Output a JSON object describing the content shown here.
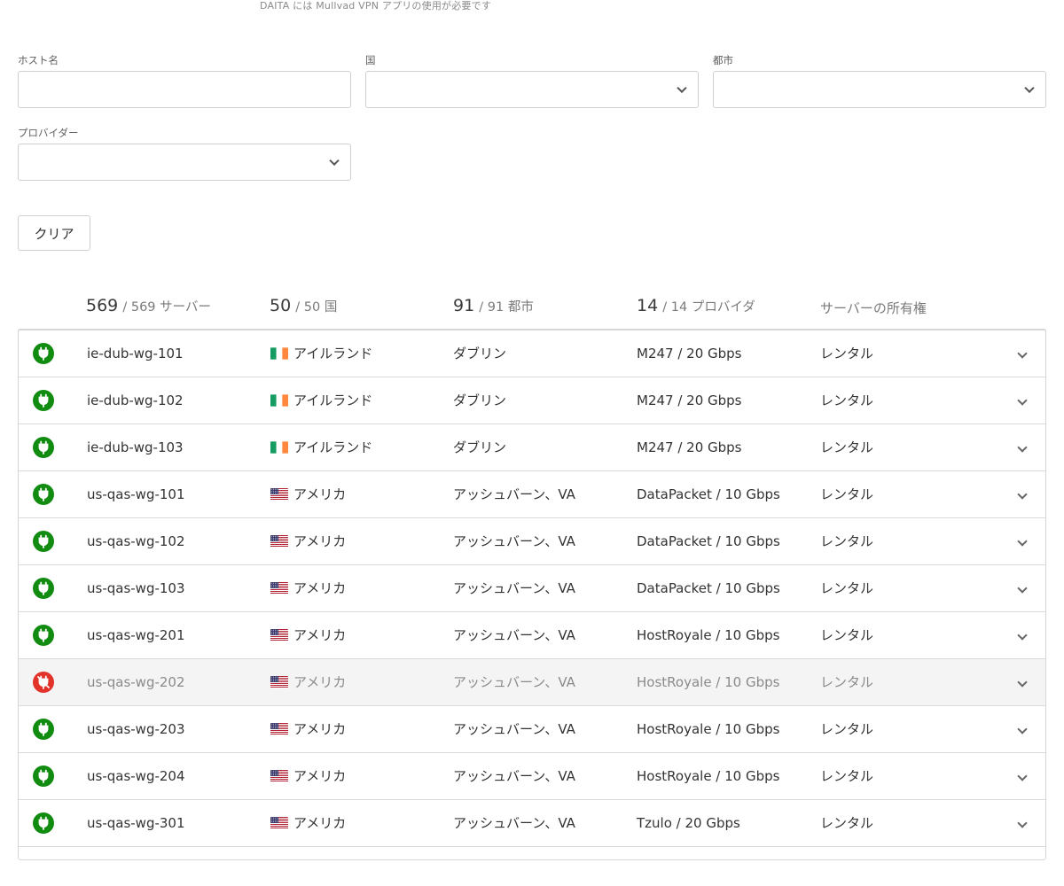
{
  "top_note": "DAITA には Mullvad VPN アプリの使用が必要です",
  "filters": {
    "hostname": {
      "label": "ホスト名",
      "value": "",
      "placeholder": ""
    },
    "country": {
      "label": "国",
      "value": ""
    },
    "city": {
      "label": "都市",
      "value": ""
    },
    "provider": {
      "label": "プロバイダー",
      "value": ""
    }
  },
  "clear_label": "クリア",
  "summary": {
    "servers": {
      "count": "569",
      "total": "/ 569 サーバー"
    },
    "countries": {
      "count": "50",
      "total": "/ 50 国"
    },
    "cities": {
      "count": "91",
      "total": "/ 91 都市"
    },
    "providers": {
      "count": "14",
      "total": "/ 14 プロバイダ"
    },
    "ownership_label": "サーバーの所有権"
  },
  "colors": {
    "active": "#118c11",
    "inactive": "#e2332b"
  },
  "servers": [
    {
      "hostname": "ie-dub-wg-101",
      "flag": "ie",
      "country": "アイルランド",
      "city": "ダブリン",
      "provider": "M247 / 20 Gbps",
      "ownership": "レンタル",
      "status": "active"
    },
    {
      "hostname": "ie-dub-wg-102",
      "flag": "ie",
      "country": "アイルランド",
      "city": "ダブリン",
      "provider": "M247 / 20 Gbps",
      "ownership": "レンタル",
      "status": "active"
    },
    {
      "hostname": "ie-dub-wg-103",
      "flag": "ie",
      "country": "アイルランド",
      "city": "ダブリン",
      "provider": "M247 / 20 Gbps",
      "ownership": "レンタル",
      "status": "active"
    },
    {
      "hostname": "us-qas-wg-101",
      "flag": "us",
      "country": "アメリカ",
      "city": "アッシュバーン、VA",
      "provider": "DataPacket / 10 Gbps",
      "ownership": "レンタル",
      "status": "active"
    },
    {
      "hostname": "us-qas-wg-102",
      "flag": "us",
      "country": "アメリカ",
      "city": "アッシュバーン、VA",
      "provider": "DataPacket / 10 Gbps",
      "ownership": "レンタル",
      "status": "active"
    },
    {
      "hostname": "us-qas-wg-103",
      "flag": "us",
      "country": "アメリカ",
      "city": "アッシュバーン、VA",
      "provider": "DataPacket / 10 Gbps",
      "ownership": "レンタル",
      "status": "active"
    },
    {
      "hostname": "us-qas-wg-201",
      "flag": "us",
      "country": "アメリカ",
      "city": "アッシュバーン、VA",
      "provider": "HostRoyale / 10 Gbps",
      "ownership": "レンタル",
      "status": "active"
    },
    {
      "hostname": "us-qas-wg-202",
      "flag": "us",
      "country": "アメリカ",
      "city": "アッシュバーン、VA",
      "provider": "HostRoyale / 10 Gbps",
      "ownership": "レンタル",
      "status": "inactive"
    },
    {
      "hostname": "us-qas-wg-203",
      "flag": "us",
      "country": "アメリカ",
      "city": "アッシュバーン、VA",
      "provider": "HostRoyale / 10 Gbps",
      "ownership": "レンタル",
      "status": "active"
    },
    {
      "hostname": "us-qas-wg-204",
      "flag": "us",
      "country": "アメリカ",
      "city": "アッシュバーン、VA",
      "provider": "HostRoyale / 10 Gbps",
      "ownership": "レンタル",
      "status": "active"
    },
    {
      "hostname": "us-qas-wg-301",
      "flag": "us",
      "country": "アメリカ",
      "city": "アッシュバーン、VA",
      "provider": "Tzulo / 20 Gbps",
      "ownership": "レンタル",
      "status": "active"
    }
  ]
}
